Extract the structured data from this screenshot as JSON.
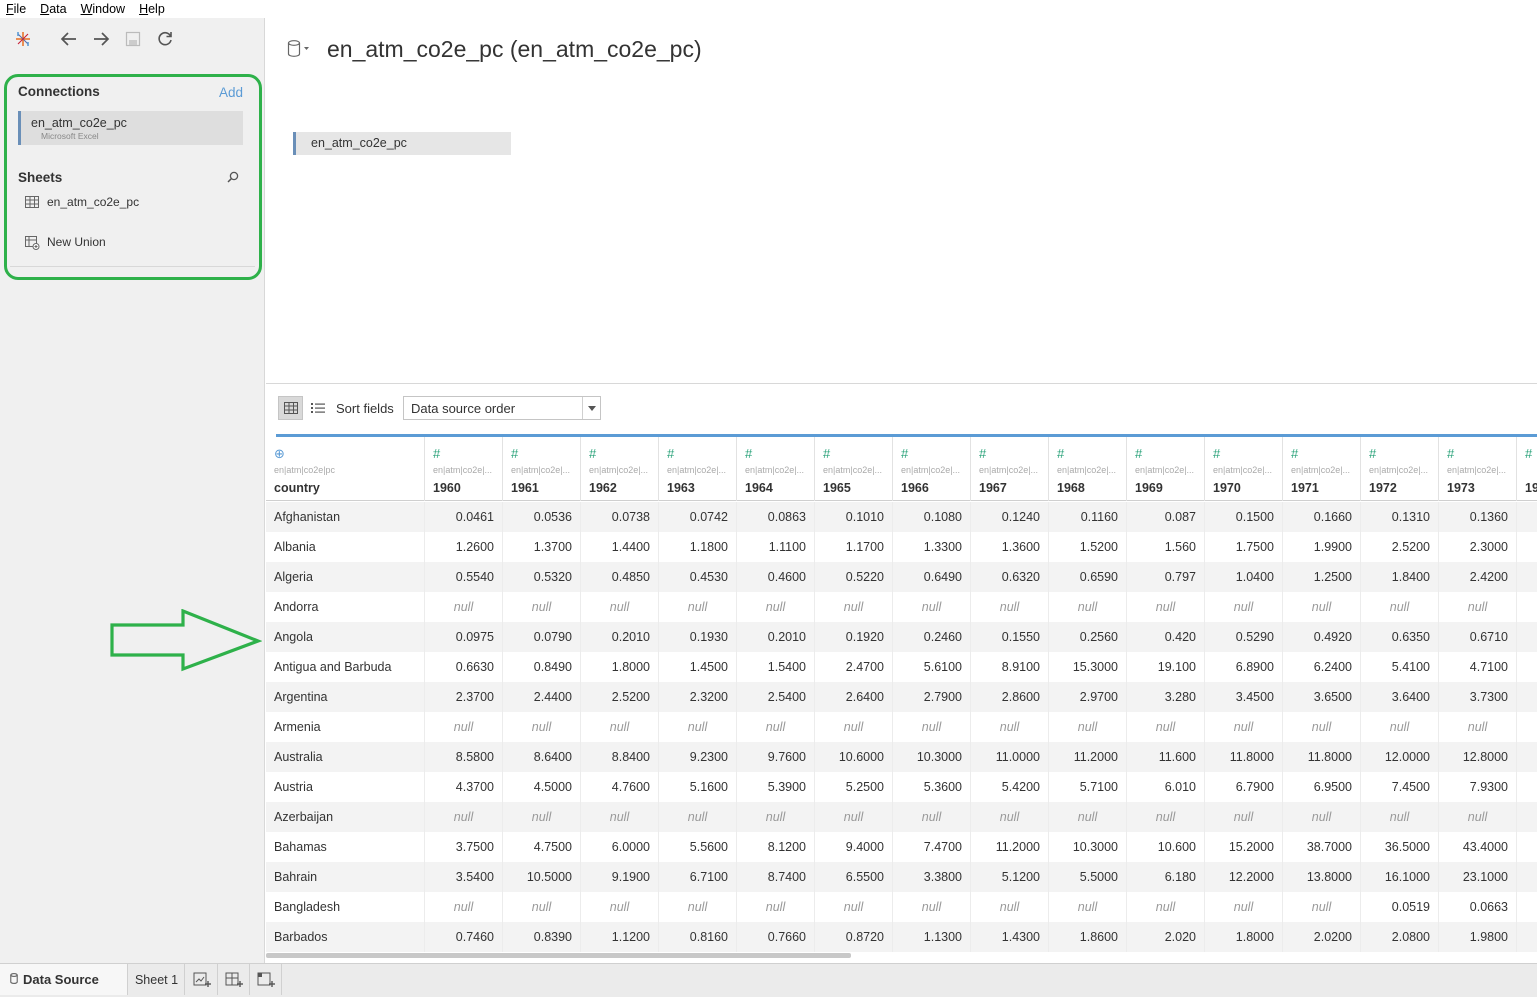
{
  "menu": [
    "File",
    "Data",
    "Window",
    "Help"
  ],
  "sidebar": {
    "connections_title": "Connections",
    "add_label": "Add",
    "connection": {
      "name": "en_atm_co2e_pc",
      "type": "Microsoft Excel"
    },
    "sheets_title": "Sheets",
    "sheets": [
      {
        "label": "en_atm_co2e_pc",
        "icon": "table-icon"
      },
      {
        "label": "New Union",
        "icon": "union-icon"
      }
    ]
  },
  "datasource": {
    "title": "en_atm_co2e_pc (en_atm_co2e_pc)",
    "table_chip": "en_atm_co2e_pc"
  },
  "grid_toolbar": {
    "sort_label": "Sort fields",
    "sort_value": "Data source order"
  },
  "grid": {
    "columns": [
      {
        "icon": "⊕",
        "source": "en|atm|co2e|pc",
        "name": "country"
      },
      {
        "icon": "#",
        "source": "en|atm|co2e|...",
        "name": "1960"
      },
      {
        "icon": "#",
        "source": "en|atm|co2e|...",
        "name": "1961"
      },
      {
        "icon": "#",
        "source": "en|atm|co2e|...",
        "name": "1962"
      },
      {
        "icon": "#",
        "source": "en|atm|co2e|...",
        "name": "1963"
      },
      {
        "icon": "#",
        "source": "en|atm|co2e|...",
        "name": "1964"
      },
      {
        "icon": "#",
        "source": "en|atm|co2e|...",
        "name": "1965"
      },
      {
        "icon": "#",
        "source": "en|atm|co2e|...",
        "name": "1966"
      },
      {
        "icon": "#",
        "source": "en|atm|co2e|...",
        "name": "1967"
      },
      {
        "icon": "#",
        "source": "en|atm|co2e|...",
        "name": "1968"
      },
      {
        "icon": "#",
        "source": "en|atm|co2e|...",
        "name": "1969"
      },
      {
        "icon": "#",
        "source": "en|atm|co2e|...",
        "name": "1970"
      },
      {
        "icon": "#",
        "source": "en|atm|co2e|...",
        "name": "1971"
      },
      {
        "icon": "#",
        "source": "en|atm|co2e|...",
        "name": "1972"
      },
      {
        "icon": "#",
        "source": "en|atm|co2e|...",
        "name": "1973"
      },
      {
        "icon": "#",
        "source": "",
        "name": "19"
      }
    ],
    "rows": [
      [
        "Afghanistan",
        "0.0461",
        "0.0536",
        "0.0738",
        "0.0742",
        "0.0863",
        "0.1010",
        "0.1080",
        "0.1240",
        "0.1160",
        "0.087",
        "0.1500",
        "0.1660",
        "0.1310",
        "0.1360"
      ],
      [
        "Albania",
        "1.2600",
        "1.3700",
        "1.4400",
        "1.1800",
        "1.1100",
        "1.1700",
        "1.3300",
        "1.3600",
        "1.5200",
        "1.560",
        "1.7500",
        "1.9900",
        "2.5200",
        "2.3000"
      ],
      [
        "Algeria",
        "0.5540",
        "0.5320",
        "0.4850",
        "0.4530",
        "0.4600",
        "0.5220",
        "0.6490",
        "0.6320",
        "0.6590",
        "0.797",
        "1.0400",
        "1.2500",
        "1.8400",
        "2.4200"
      ],
      [
        "Andorra",
        "null",
        "null",
        "null",
        "null",
        "null",
        "null",
        "null",
        "null",
        "null",
        "null",
        "null",
        "null",
        "null",
        "null"
      ],
      [
        "Angola",
        "0.0975",
        "0.0790",
        "0.2010",
        "0.1930",
        "0.2010",
        "0.1920",
        "0.2460",
        "0.1550",
        "0.2560",
        "0.420",
        "0.5290",
        "0.4920",
        "0.6350",
        "0.6710"
      ],
      [
        "Antigua and Barbuda",
        "0.6630",
        "0.8490",
        "1.8000",
        "1.4500",
        "1.5400",
        "2.4700",
        "5.6100",
        "8.9100",
        "15.3000",
        "19.100",
        "6.8900",
        "6.2400",
        "5.4100",
        "4.7100"
      ],
      [
        "Argentina",
        "2.3700",
        "2.4400",
        "2.5200",
        "2.3200",
        "2.5400",
        "2.6400",
        "2.7900",
        "2.8600",
        "2.9700",
        "3.280",
        "3.4500",
        "3.6500",
        "3.6400",
        "3.7300"
      ],
      [
        "Armenia",
        "null",
        "null",
        "null",
        "null",
        "null",
        "null",
        "null",
        "null",
        "null",
        "null",
        "null",
        "null",
        "null",
        "null"
      ],
      [
        "Australia",
        "8.5800",
        "8.6400",
        "8.8400",
        "9.2300",
        "9.7600",
        "10.6000",
        "10.3000",
        "11.0000",
        "11.2000",
        "11.600",
        "11.8000",
        "11.8000",
        "12.0000",
        "12.8000"
      ],
      [
        "Austria",
        "4.3700",
        "4.5000",
        "4.7600",
        "5.1600",
        "5.3900",
        "5.2500",
        "5.3600",
        "5.4200",
        "5.7100",
        "6.010",
        "6.7900",
        "6.9500",
        "7.4500",
        "7.9300"
      ],
      [
        "Azerbaijan",
        "null",
        "null",
        "null",
        "null",
        "null",
        "null",
        "null",
        "null",
        "null",
        "null",
        "null",
        "null",
        "null",
        "null"
      ],
      [
        "Bahamas",
        "3.7500",
        "4.7500",
        "6.0000",
        "5.5600",
        "8.1200",
        "9.4000",
        "7.4700",
        "11.2000",
        "10.3000",
        "10.600",
        "15.2000",
        "38.7000",
        "36.5000",
        "43.4000"
      ],
      [
        "Bahrain",
        "3.5400",
        "10.5000",
        "9.1900",
        "6.7100",
        "8.7400",
        "6.5500",
        "3.3800",
        "5.1200",
        "5.5000",
        "6.180",
        "12.2000",
        "13.8000",
        "16.1000",
        "23.1000"
      ],
      [
        "Bangladesh",
        "null",
        "null",
        "null",
        "null",
        "null",
        "null",
        "null",
        "null",
        "null",
        "null",
        "null",
        "null",
        "0.0519",
        "0.0663"
      ],
      [
        "Barbados",
        "0.7460",
        "0.8390",
        "1.1200",
        "0.8160",
        "0.7660",
        "0.8720",
        "1.1300",
        "1.4300",
        "1.8600",
        "2.020",
        "1.8000",
        "2.0200",
        "2.0800",
        "1.9800"
      ]
    ]
  },
  "tabs": {
    "data_source": "Data Source",
    "sheet": "Sheet 1"
  },
  "colors": {
    "accent_blue": "#5b9bd5",
    "annotation_green": "#2eb14a",
    "field_icon_green": "#2aa37a"
  }
}
